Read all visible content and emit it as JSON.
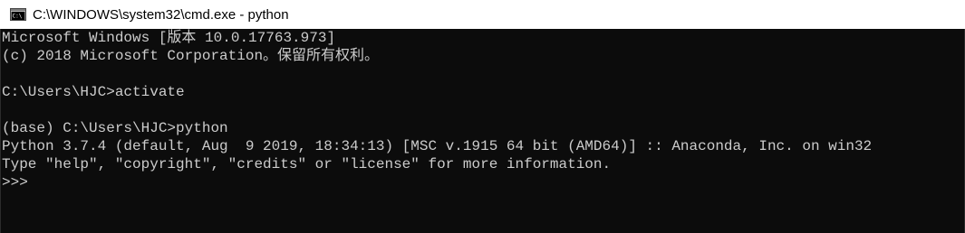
{
  "window": {
    "title": "C:\\WINDOWS\\system32\\cmd.exe - python",
    "icon": "cmd-icon"
  },
  "console": {
    "lines": [
      "Microsoft Windows [版本 10.0.17763.973]",
      "(c) 2018 Microsoft Corporation。保留所有权利。",
      "",
      "C:\\Users\\HJC>activate",
      "",
      "(base) C:\\Users\\HJC>python",
      "Python 3.7.4 (default, Aug  9 2019, 18:34:13) [MSC v.1915 64 bit (AMD64)] :: Anaconda, Inc. on win32",
      "Type \"help\", \"copyright\", \"credits\" or \"license\" for more information.",
      ">>>"
    ]
  },
  "colors": {
    "console_background": "#0c0c0c",
    "console_text": "#cccccc",
    "titlebar_background": "#ffffff"
  }
}
